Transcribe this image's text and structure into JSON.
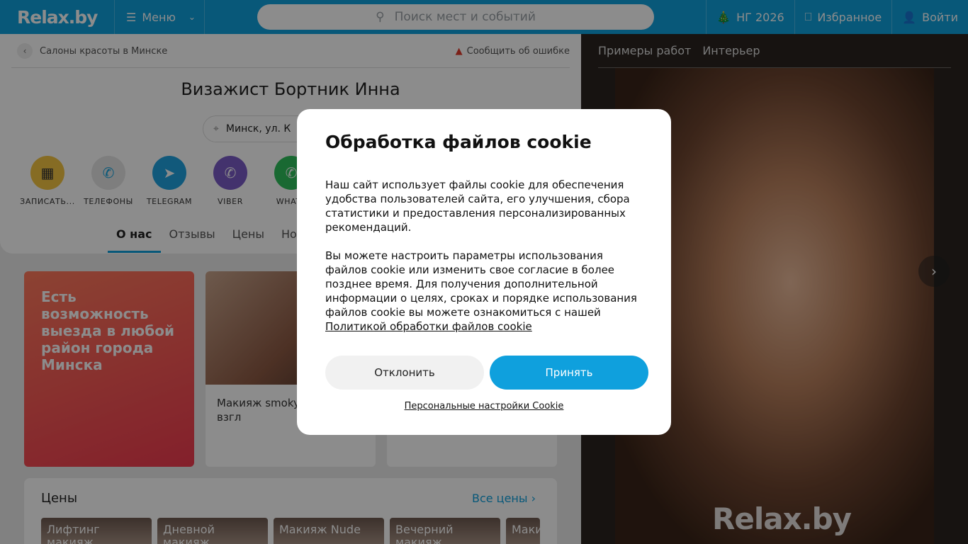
{
  "header": {
    "logo": "Relax.by",
    "menu_label": "Меню",
    "search_placeholder": "Поиск мест и событий",
    "ny_label": "НГ 2026",
    "favorites_label": "Избранное",
    "login_label": "Войти"
  },
  "breadcrumb": {
    "back_label": "Салоны красоты в Минске",
    "report_label": "Сообщить об ошибке"
  },
  "profile": {
    "title": "Визажист Бортник Инна",
    "address": "Минск, ул. К"
  },
  "actions": [
    {
      "label": "ЗАПИСАТЬ...",
      "icon": "calendar-icon",
      "color": "#f5c542"
    },
    {
      "label": "ТЕЛЕФОНЫ",
      "icon": "phone-icon",
      "color": "#e6e6e6"
    },
    {
      "label": "TELEGRAM",
      "icon": "telegram-icon",
      "color": "#1fa3e1"
    },
    {
      "label": "VIBER",
      "icon": "viber-icon",
      "color": "#7b5cc7"
    },
    {
      "label": "WHATS",
      "icon": "whatsapp-icon",
      "color": "#2fbf5b"
    }
  ],
  "tabs": [
    {
      "label": "О нас",
      "active": true
    },
    {
      "label": "Отзывы"
    },
    {
      "label": "Цены"
    },
    {
      "label": "Нов"
    }
  ],
  "promo": {
    "text": "Есть возможность выезда в любой район города Минска"
  },
  "card": {
    "caption": "Макияж smoky акцент на взгл"
  },
  "prices": {
    "title": "Цены",
    "all_label": "Все цены",
    "items": [
      "Лифтинг макияж",
      "Дневной макияж",
      "Макияж Nude",
      "Вечерний макияж",
      "Маки"
    ]
  },
  "gallery": {
    "tabs": [
      "Примеры работ",
      "Интерьер"
    ],
    "watermark": "Relax.by"
  },
  "cookie": {
    "title": "Обработка файлов cookie",
    "paragraph1": "Наш сайт использует файлы cookie для обеспечения удобства пользователей сайта, его улучшения, сбора статистики и предоставления персонализированных рекомендаций.",
    "paragraph2": "Вы можете настроить параметры использования файлов cookie или изменить свое согласие в более позднее время. Для получения дополнительной информации о целях, сроках и порядке использования файлов cookie вы можете ознакомиться с нашей",
    "policy_link": "Политикой обработки файлов cookie",
    "decline_label": "Отклонить",
    "accept_label": "Принять",
    "settings_label": "Персональные настройки Cookie"
  },
  "colors": {
    "brand": "#0fa0dd",
    "promo": "#f03a4f"
  }
}
